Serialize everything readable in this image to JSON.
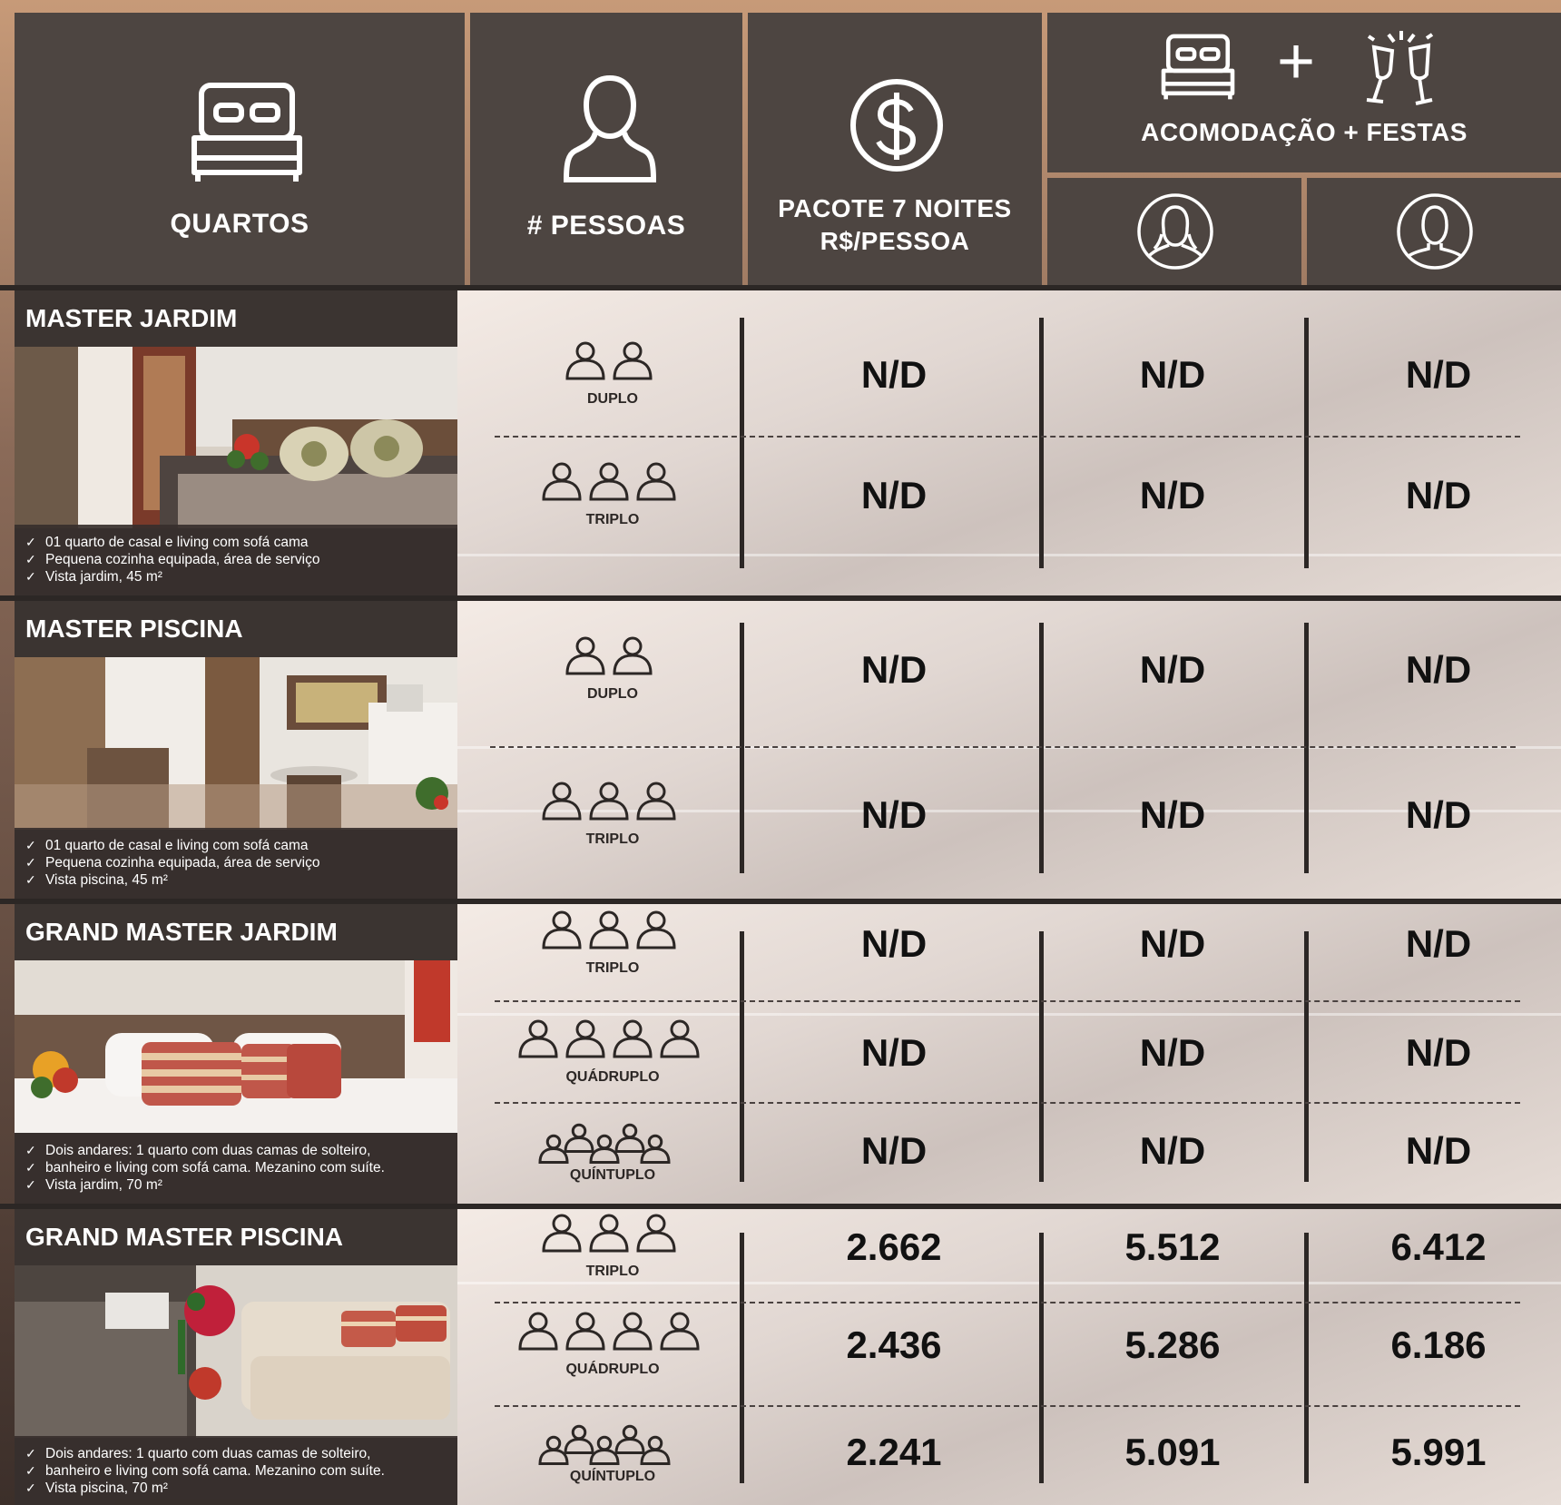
{
  "header": {
    "rooms_label": "QUARTOS",
    "people_label": "# PESSOAS",
    "package_label_line1": "PACOTE 7 NOITES",
    "package_label_line2": "R$/PESSOA",
    "combo_label": "ACOMODAÇÃO + FESTAS",
    "combo_plus": "+"
  },
  "rooms": [
    {
      "name": "MASTER JARDIM",
      "desc": [
        "01 quarto de casal e living com sofá cama",
        "Pequena cozinha equipada, área de serviço",
        "Vista jardim, 45 m²"
      ],
      "rows": [
        {
          "type": "DUPLO",
          "package": "N/D",
          "female": "N/D",
          "male": "N/D"
        },
        {
          "type": "TRIPLO",
          "package": "N/D",
          "female": "N/D",
          "male": "N/D"
        }
      ]
    },
    {
      "name": "MASTER PISCINA",
      "desc": [
        "01 quarto de casal e living com sofá cama",
        "Pequena cozinha equipada, área de serviço",
        "Vista piscina, 45 m²"
      ],
      "rows": [
        {
          "type": "DUPLO",
          "package": "N/D",
          "female": "N/D",
          "male": "N/D"
        },
        {
          "type": "TRIPLO",
          "package": "N/D",
          "female": "N/D",
          "male": "N/D"
        }
      ]
    },
    {
      "name": "GRAND MASTER JARDIM",
      "desc": [
        "Dois andares: 1 quarto com duas camas de solteiro,",
        "banheiro e living com sofá cama. Mezanino com suíte.",
        "Vista jardim, 70 m²"
      ],
      "rows": [
        {
          "type": "TRIPLO",
          "package": "N/D",
          "female": "N/D",
          "male": "N/D"
        },
        {
          "type": "QUÁDRUPLO",
          "package": "N/D",
          "female": "N/D",
          "male": "N/D"
        },
        {
          "type": "QUÍNTUPLO",
          "package": "N/D",
          "female": "N/D",
          "male": "N/D"
        }
      ]
    },
    {
      "name": "GRAND MASTER PISCINA",
      "desc": [
        "Dois andares: 1 quarto com duas camas de solteiro,",
        "banheiro e living com sofá cama. Mezanino com suíte.",
        "Vista piscina, 70 m²"
      ],
      "rows": [
        {
          "type": "TRIPLO",
          "package": "2.662",
          "female": "5.512",
          "male": "6.412"
        },
        {
          "type": "QUÁDRUPLO",
          "package": "2.436",
          "female": "5.286",
          "male": "6.186"
        },
        {
          "type": "QUÍNTUPLO",
          "package": "2.241",
          "female": "5.091",
          "male": "5.991"
        }
      ]
    }
  ],
  "icons": {
    "bed": "bed-icon",
    "person": "person-icon",
    "dollar": "dollar-coin-icon",
    "toast": "champagne-toast-icon",
    "female": "female-avatar-icon",
    "male": "male-avatar-icon"
  },
  "colors": {
    "header_bg": "#4d4541",
    "panel_bg": "#3b3431",
    "divider": "#2c2725",
    "text_dark": "#111111"
  }
}
